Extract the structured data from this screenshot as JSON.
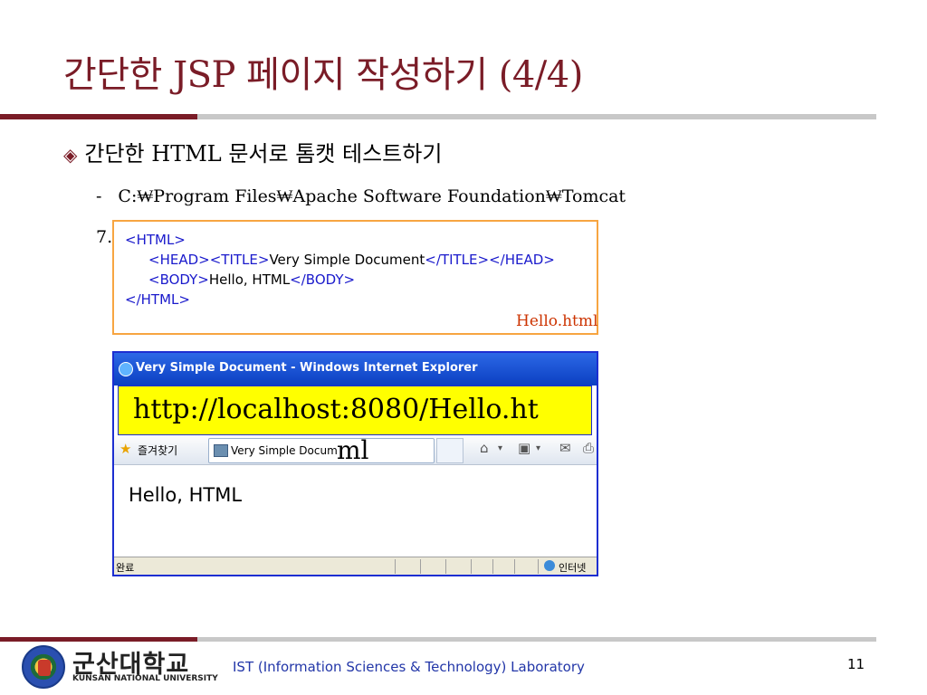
{
  "slide": {
    "title": "간단한 JSP 페이지 작성하기 (4/4)",
    "bullet": "간단한 HTML 문서로 톰캣 테스트하기",
    "sub_line1": "C:₩Program Files₩Apache Software Foundation₩Tomcat",
    "sub_line2": "7.",
    "page_number": "11"
  },
  "code": {
    "lines": [
      {
        "parts": [
          "<HTML>",
          "",
          "",
          "",
          "",
          ""
        ]
      },
      {
        "parts": [
          "<HEAD>",
          "<TITLE>",
          "Very Simple Document",
          "</TITLE>",
          "</HEAD>"
        ]
      },
      {
        "parts": [
          "<BODY>",
          "Hello, HTML",
          "</BODY>"
        ]
      },
      {
        "parts": [
          "</HTML>"
        ]
      }
    ],
    "filename": "Hello.html"
  },
  "browser": {
    "window_title": "Very Simple Document - Windows Internet Explorer",
    "url_part1": "http://localhost:8080/Hello.ht",
    "url_part2": "ml",
    "favorites_label": "즐겨찾기",
    "tab_title": "Very Simple Docum",
    "page_content": "Hello, HTML",
    "status_text": "완료",
    "status_zone": "인터넷"
  },
  "footer": {
    "university_kr": "군산대학교",
    "university_en": "KUNSAN NATIONAL UNIVERSITY",
    "lab": "IST (Information Sciences & Technology) Laboratory"
  },
  "colors": {
    "accent": "#7a1c27",
    "code_tag": "#1a1acc",
    "code_border": "#f7a541",
    "url_highlight": "#ffff00",
    "footer_text": "#2236a8"
  }
}
